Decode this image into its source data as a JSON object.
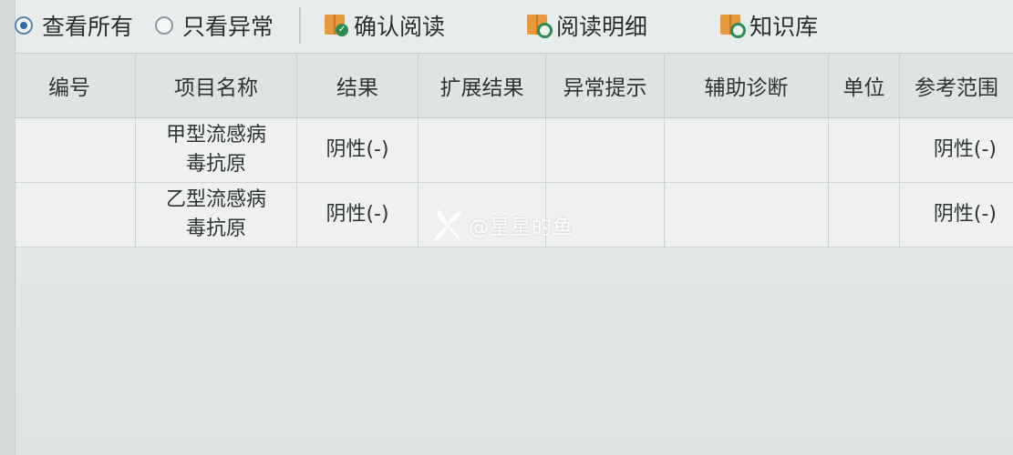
{
  "toolbar": {
    "view_all_label": "查看所有",
    "view_abnormal_label": "只看异常",
    "confirm_read_label": "确认阅读",
    "read_detail_label": "阅读明细",
    "knowledge_base_label": "知识库",
    "selected_option": "查看所有"
  },
  "table": {
    "columns": [
      "编号",
      "项目名称",
      "结果",
      "扩展结果",
      "异常提示",
      "辅助诊断",
      "单位",
      "参考范围"
    ],
    "rows": [
      {
        "number": "",
        "item_line1": "甲型流感病",
        "item_line2": "毒抗原",
        "result": "阴性(-)",
        "extended": "",
        "abnormal": "",
        "diagnosis": "",
        "unit": "",
        "reference": "阴性(-)"
      },
      {
        "number": "",
        "item_line1": "乙型流感病",
        "item_line2": "毒抗原",
        "result": "阴性(-)",
        "extended": "",
        "abnormal": "",
        "diagnosis": "",
        "unit": "",
        "reference": "阴性(-)"
      }
    ]
  },
  "watermark": {
    "text": "@星星的鱼",
    "icon": "leaf-icon"
  },
  "colors": {
    "radio_accent": "#2f6fa3",
    "book_icon": "#e79a3d",
    "badge_green": "#2e8b57",
    "header_bg": "#dfe4e3"
  }
}
